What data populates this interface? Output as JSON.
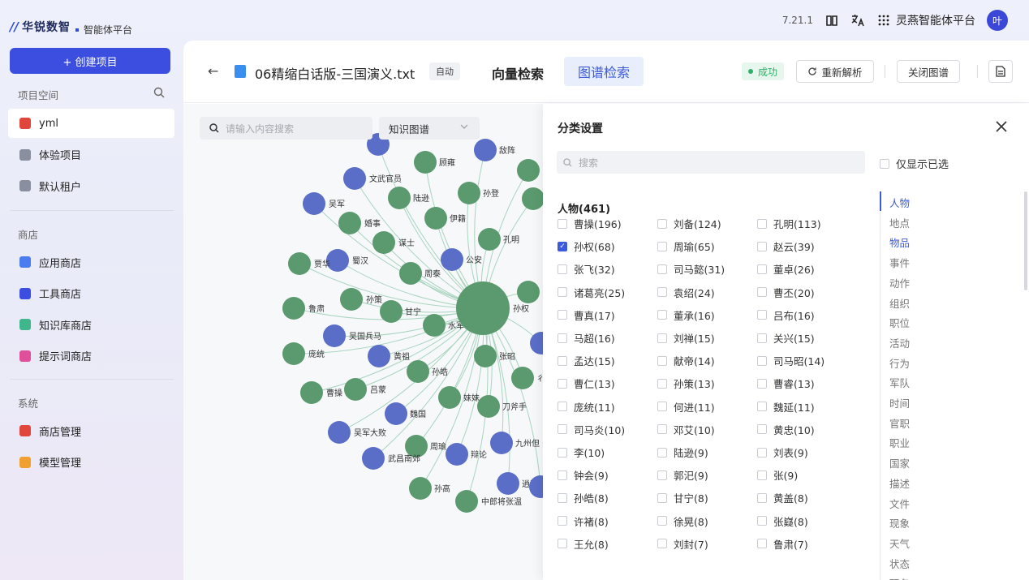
{
  "brand": {
    "mark": "//",
    "name": "华锐数智",
    "subtitle": "智能体平台"
  },
  "topbar": {
    "version": "7.21.1",
    "book_icon": "book-icon",
    "translate_icon": "translate-icon",
    "grid_icon": "grid-icon",
    "platform_name": "灵燕智能体平台",
    "avatar_text": "叶"
  },
  "sidebar": {
    "create_label": "+ 创建项目",
    "project_section": "项目空间",
    "projects": [
      {
        "label": "yml",
        "active": true,
        "color": "#e0463c"
      },
      {
        "label": "体验项目",
        "active": false,
        "color": "#8a8fa0"
      },
      {
        "label": "默认租户",
        "active": false,
        "color": "#8a8fa0"
      }
    ],
    "store_section": "商店",
    "stores": [
      {
        "label": "应用商店",
        "icon": "robot-icon",
        "color": "#4a7cf0"
      },
      {
        "label": "工具商店",
        "icon": "tool-icon",
        "color": "#3b4ee0"
      },
      {
        "label": "知识库商店",
        "icon": "database-icon",
        "color": "#3fb68b"
      },
      {
        "label": "提示词商店",
        "icon": "sparkle-icon",
        "color": "#e0509a"
      }
    ],
    "system_section": "系统",
    "systems": [
      {
        "label": "商店管理",
        "icon": "shop-icon",
        "color": "#e0463c"
      },
      {
        "label": "模型管理",
        "icon": "cube-icon",
        "color": "#f0a030"
      }
    ]
  },
  "header": {
    "back": "←",
    "file_name": "06精缩白话版-三国演义.txt",
    "auto_tag": "自动",
    "tab_vector": "向量检索",
    "tab_graph": "图谱检索",
    "status": "成功",
    "reparse": "重新解析",
    "close_graph": "关闭图谱"
  },
  "graph": {
    "search_placeholder": "请输入内容搜索",
    "select_value": "知识图谱",
    "colors": {
      "person": "#5a9a6e",
      "other": "#5a6ec8",
      "edge": "#a8d4be"
    },
    "center": {
      "label": "孙权",
      "kind": "person"
    },
    "nodes": [
      {
        "label": "",
        "kind": "other"
      },
      {
        "label": "敌阵",
        "kind": "other"
      },
      {
        "label": "顾雍",
        "kind": "person"
      },
      {
        "label": "文武官员",
        "kind": "other"
      },
      {
        "label": "陆逊",
        "kind": "person"
      },
      {
        "label": "孙登",
        "kind": "person"
      },
      {
        "label": "吴军",
        "kind": "other"
      },
      {
        "label": "婚事",
        "kind": "person"
      },
      {
        "label": "伊籍",
        "kind": "person"
      },
      {
        "label": "谋士",
        "kind": "person"
      },
      {
        "label": "孔明",
        "kind": "person"
      },
      {
        "label": "蜀汉",
        "kind": "other"
      },
      {
        "label": "贾华",
        "kind": "person"
      },
      {
        "label": "公安",
        "kind": "other"
      },
      {
        "label": "周泰",
        "kind": "person"
      },
      {
        "label": "孙策",
        "kind": "person"
      },
      {
        "label": "鲁肃",
        "kind": "person"
      },
      {
        "label": "甘宁",
        "kind": "person"
      },
      {
        "label": "水军",
        "kind": "person"
      },
      {
        "label": "吴国兵马",
        "kind": "other"
      },
      {
        "label": "庞统",
        "kind": "person"
      },
      {
        "label": "黄祖",
        "kind": "other"
      },
      {
        "label": "张昭",
        "kind": "person"
      },
      {
        "label": "孙皓",
        "kind": "person"
      },
      {
        "label": "曹操",
        "kind": "person"
      },
      {
        "label": "吕蒙",
        "kind": "person"
      },
      {
        "label": "妹妹",
        "kind": "person"
      },
      {
        "label": "魏国",
        "kind": "other"
      },
      {
        "label": "刀斧手",
        "kind": "person"
      },
      {
        "label": "吴军大败",
        "kind": "other"
      },
      {
        "label": "周瑜",
        "kind": "person"
      },
      {
        "label": "辩论",
        "kind": "other"
      },
      {
        "label": "九州但",
        "kind": "other"
      },
      {
        "label": "武昌南郊",
        "kind": "other"
      },
      {
        "label": "孙高",
        "kind": "person"
      },
      {
        "label": "逍遥津",
        "kind": "other"
      },
      {
        "label": "中郎将张温",
        "kind": "person"
      },
      {
        "label": "",
        "kind": "person"
      },
      {
        "label": "",
        "kind": "person"
      },
      {
        "label": "",
        "kind": "person"
      },
      {
        "label": "",
        "kind": "other"
      },
      {
        "label": "彳",
        "kind": "person"
      },
      {
        "label": "",
        "kind": "other"
      }
    ]
  },
  "panel": {
    "title": "分类设置",
    "search_placeholder": "搜索",
    "only_selected": "仅显示已选",
    "group_title": "人物(461)",
    "items": [
      {
        "label": "曹操(196)",
        "checked": false
      },
      {
        "label": "刘备(124)",
        "checked": false
      },
      {
        "label": "孔明(113)",
        "checked": false
      },
      {
        "label": "孙权(68)",
        "checked": true
      },
      {
        "label": "周瑜(65)",
        "checked": false
      },
      {
        "label": "赵云(39)",
        "checked": false
      },
      {
        "label": "张飞(32)",
        "checked": false
      },
      {
        "label": "司马懿(31)",
        "checked": false
      },
      {
        "label": "董卓(26)",
        "checked": false
      },
      {
        "label": "诸葛亮(25)",
        "checked": false
      },
      {
        "label": "袁绍(24)",
        "checked": false
      },
      {
        "label": "曹丕(20)",
        "checked": false
      },
      {
        "label": "曹真(17)",
        "checked": false
      },
      {
        "label": "董承(16)",
        "checked": false
      },
      {
        "label": "吕布(16)",
        "checked": false
      },
      {
        "label": "马超(16)",
        "checked": false
      },
      {
        "label": "刘禅(15)",
        "checked": false
      },
      {
        "label": "关兴(15)",
        "checked": false
      },
      {
        "label": "孟达(15)",
        "checked": false
      },
      {
        "label": "献帝(14)",
        "checked": false
      },
      {
        "label": "司马昭(14)",
        "checked": false
      },
      {
        "label": "曹仁(13)",
        "checked": false
      },
      {
        "label": "孙策(13)",
        "checked": false
      },
      {
        "label": "曹睿(13)",
        "checked": false
      },
      {
        "label": "庞统(11)",
        "checked": false
      },
      {
        "label": "何进(11)",
        "checked": false
      },
      {
        "label": "魏延(11)",
        "checked": false
      },
      {
        "label": "司马炎(10)",
        "checked": false
      },
      {
        "label": "邓艾(10)",
        "checked": false
      },
      {
        "label": "黄忠(10)",
        "checked": false
      },
      {
        "label": "李(10)",
        "checked": false
      },
      {
        "label": "陆逊(9)",
        "checked": false
      },
      {
        "label": "刘表(9)",
        "checked": false
      },
      {
        "label": "钟会(9)",
        "checked": false
      },
      {
        "label": "郭汜(9)",
        "checked": false
      },
      {
        "label": "张(9)",
        "checked": false
      },
      {
        "label": "孙皓(8)",
        "checked": false
      },
      {
        "label": "甘宁(8)",
        "checked": false
      },
      {
        "label": "黄盖(8)",
        "checked": false
      },
      {
        "label": "许褚(8)",
        "checked": false
      },
      {
        "label": "徐晃(8)",
        "checked": false
      },
      {
        "label": "张嶷(8)",
        "checked": false
      },
      {
        "label": "王允(8)",
        "checked": false
      },
      {
        "label": "刘封(7)",
        "checked": false
      },
      {
        "label": "鲁肃(7)",
        "checked": false
      }
    ],
    "categories": [
      {
        "label": "人物",
        "active": true
      },
      {
        "label": "地点",
        "active": false
      },
      {
        "label": "物品",
        "active": true
      },
      {
        "label": "事件",
        "active": false
      },
      {
        "label": "动作",
        "active": false
      },
      {
        "label": "组织",
        "active": false
      },
      {
        "label": "职位",
        "active": false
      },
      {
        "label": "活动",
        "active": false
      },
      {
        "label": "行为",
        "active": false
      },
      {
        "label": "军队",
        "active": false
      },
      {
        "label": "时间",
        "active": false
      },
      {
        "label": "官职",
        "active": false
      },
      {
        "label": "职业",
        "active": false
      },
      {
        "label": "国家",
        "active": false
      },
      {
        "label": "描述",
        "active": false
      },
      {
        "label": "文件",
        "active": false
      },
      {
        "label": "现象",
        "active": false
      },
      {
        "label": "天气",
        "active": false
      },
      {
        "label": "状态",
        "active": false
      },
      {
        "label": "职务",
        "active": false
      }
    ]
  }
}
